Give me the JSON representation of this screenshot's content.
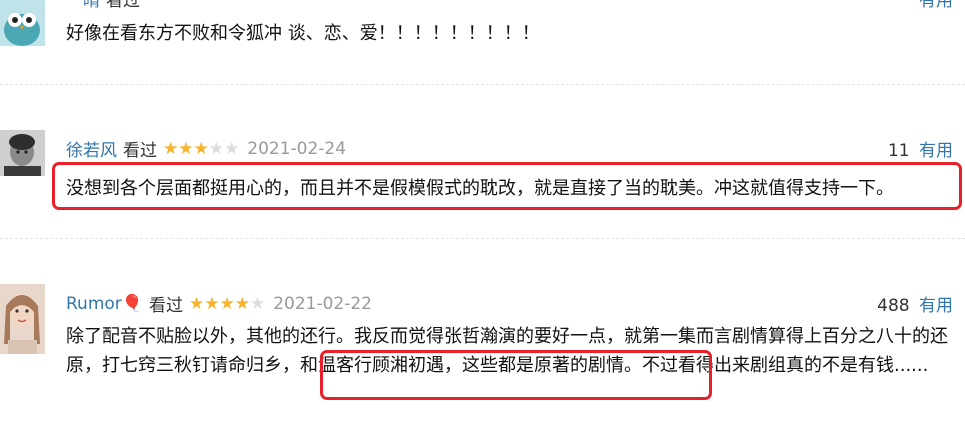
{
  "reviews": [
    {
      "author": "一晴",
      "watched": "看过",
      "votes_label": "有用",
      "text": "好像在看东方不败和令狐冲 谈、恋、爱！！！！！！！！！"
    },
    {
      "author": "徐若风",
      "watched": "看过",
      "rating": 3,
      "date": "2021-02-24",
      "votes": "11",
      "votes_label": "有用",
      "text": "没想到各个层面都挺用心的，而且并不是假模假式的耽改，就是直接了当的耽美。冲这就值得支持一下。"
    },
    {
      "author": "Rumor🎈",
      "watched": "看过",
      "rating": 4,
      "date": "2021-02-22",
      "votes": "488",
      "votes_label": "有用",
      "text": "除了配音不贴脸以外，其他的还行。我反而觉得张哲瀚演的要好一点，就第一集而言剧情算得上百分之八十的还原，打七窍三秋钉请命归乡，和温客行顾湘初遇，这些都是原著的剧情。不过看得出来剧组真的不是有钱......"
    }
  ],
  "colors": {
    "link": "#3377aa",
    "star": "#f6b32b",
    "highlight": "#e8202a"
  }
}
